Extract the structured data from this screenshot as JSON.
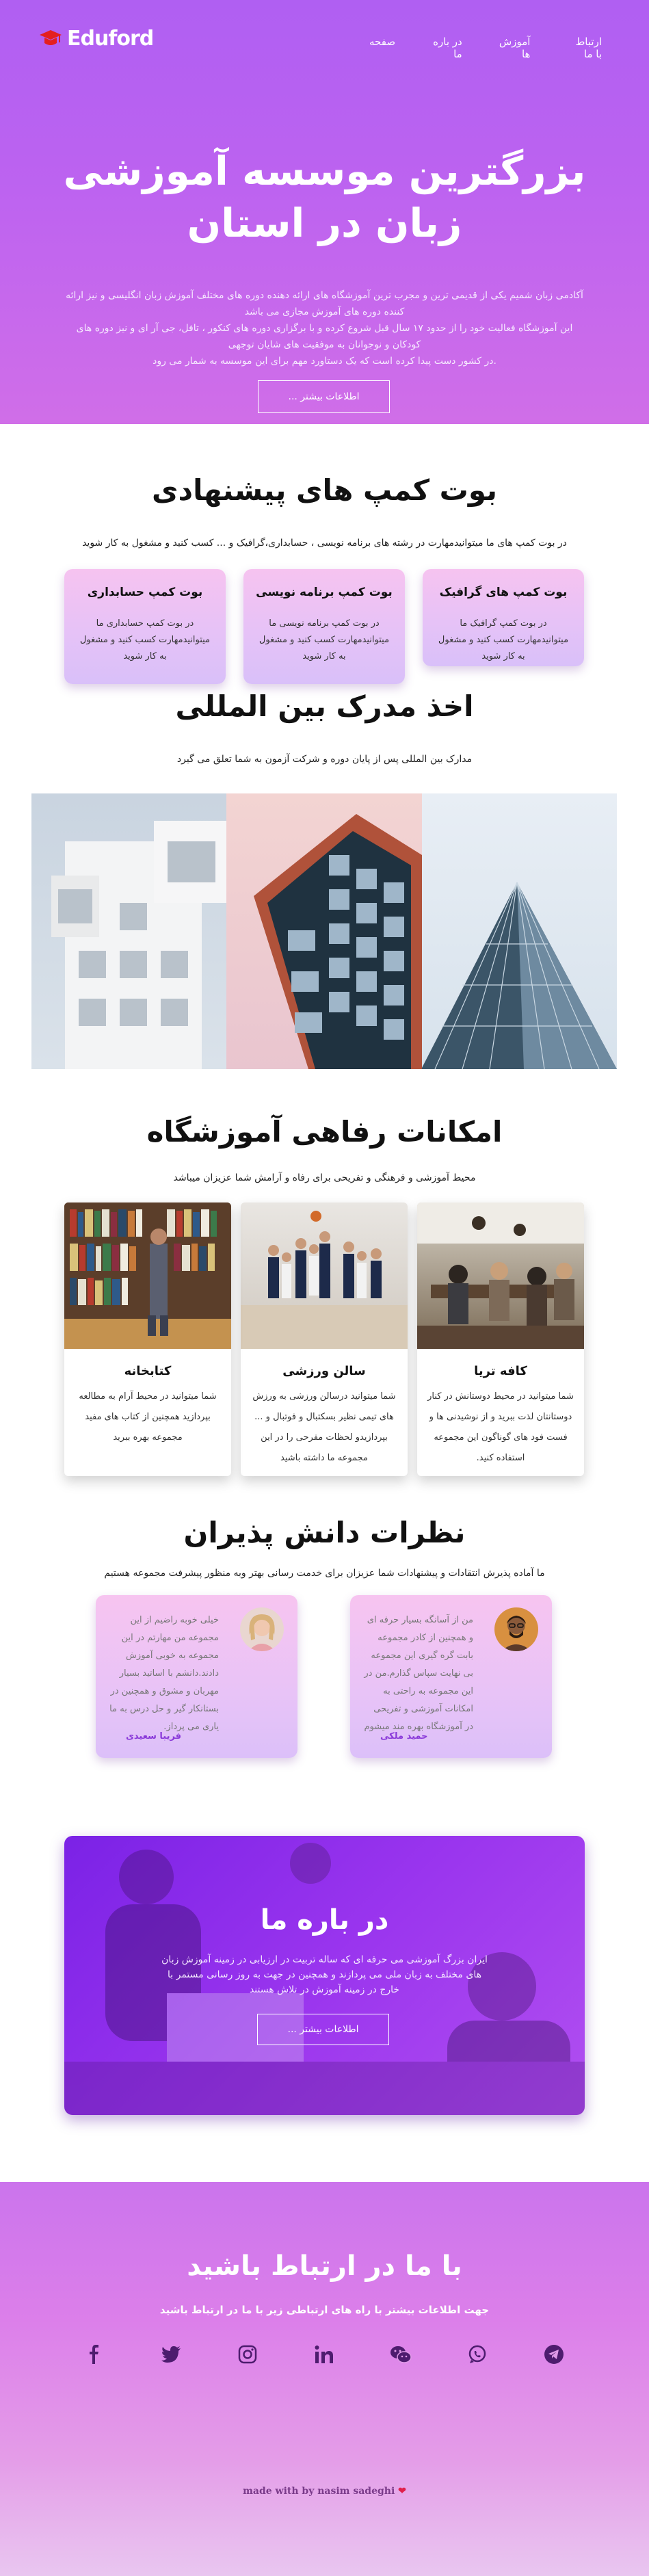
{
  "brand": {
    "name": "Eduford"
  },
  "nav": {
    "items": [
      "صفحه",
      "در باره ما",
      "آموزش ها",
      "ارتباط با ما"
    ]
  },
  "hero": {
    "title": "بزرگترین موسسه آموزشی زبان در استان",
    "desc_lines": [
      "آکادمی زبان شمیم یکی از قدیمی ترین و مجرب ترین آموزشگاه های ارائه دهنده دوره های مختلف آموزش زبان انگلیسی و نیز ارائه",
      "کننده دوره های آموزش مجازی می باشد",
      "این آموزشگاه فعالیت خود را از حدود ۱۷ سال قبل شروع کرده و با برگزاری دوره های کنکور ، تافل، جی آر ای و نیز دوره های",
      "کودکان و نوجوانان به موفقیت های شایان توجهی",
      ".در کشور دست پیدا کرده است که یک دستاورد مهم برای این موسسه به شمار می رود"
    ],
    "button": "اطلاعات بیشتر ..."
  },
  "bootcamps": {
    "title": "بوت کمپ های پیشنهادی",
    "subtitle": "در بوت کمپ های ما میتوانیدمهارت در رشته های برنامه نویسی ، حسابداری،گرافیک و ... کسب کنید و مشغول به کار شوید",
    "cards": [
      {
        "title": "بوت کمپ های گرافیک",
        "text": "در بوت کمپ گرافیک ما میتوانیدمهارت کسب کنید و مشغول به کار شوید"
      },
      {
        "title": "بوت کمپ برنامه نویسی",
        "text": "در بوت کمپ برنامه نویسی ما میتوانیدمهارت کسب کنید و مشغول به کار شوید"
      },
      {
        "title": "بوت کمپ حسابداری",
        "text": "در بوت کمپ حسابداری ما میتوانیدمهارت کسب کنید و مشغول به کار شوید"
      }
    ]
  },
  "certificate": {
    "title": "اخذ مدرک بین المللی",
    "subtitle": "مدارک بین المللی پس از پایان دوره و شرکت آزمون به شما تعلق می گیرد"
  },
  "facilities": {
    "title": "امکانات رفاهی آموزشگاه",
    "subtitle": "محیط آموزشی و فرهنگی و تفریحی برای رفاه و آرامش شما عزیزان میباشد",
    "cards": [
      {
        "title": "کافه تریا",
        "text": "شما میتوانید در محیط دوستانش در کنار دوستانتان لذت ببرید و از نوشیدنی ها و فست فود های گوناگون این مجموعه استفاده کنید."
      },
      {
        "title": "سالن ورزشی",
        "text": "شما میتوانید درسالن ورزشی به ورزش های تیمی نظیر بسکتبال و فوتبال و ... بپردازیدو لحظات مفرحی را در این مجموعه ما داشته باشید"
      },
      {
        "title": "کتابخانه",
        "text": "شما میتوانید در محیط آرام به مطالعه بپردازید همچنین از کتاب های مفید مجموعه بهره ببرید"
      }
    ]
  },
  "testimonials": {
    "title": "نظرات دانش پذیران",
    "subtitle": "ما آماده پذیرش انتقادات و پیشنهادات شما عزیزان برای خدمت رسانی بهتر وبه منظور پیشرفت مجموعه هستیم",
    "cards": [
      {
        "name": "حمید ملکی",
        "text": "من از آسانگه بسیار حرفه ای و همچنین از کادر مجموعه بابت گره گیری این مجموعه بی نهایت سپاس گذارم.من در این مجموعه به راحتی به امکانات آموزشی و تفریحی در آموزشگاه بهره مند میشوم"
      },
      {
        "name": "فریبا سعیدی",
        "text": "خیلی خوبه راضیم از این مجموعه من مهارتم در این مجموعه به خوبی آموزش دادند.دانشم با اساتید بسیار مهربان و مشوق و همچنین در بستانکار گیر و حل درس به ما یاری می پرداز."
      }
    ]
  },
  "about": {
    "title": "در باره ما",
    "desc": "ایران بزرگ آموزشی می حرفه ای که ساله تربیت در ارزیابی در زمینه آموزش زبان های مختلف به زبان ملی می پردازند و همچنین در جهت به روز رسانی مستمر با خارج در زمینه آموزش در تلاش هستند",
    "button": "اطلاعات بیشتر ..."
  },
  "contact": {
    "title": "با ما در ارتباط باشید",
    "subtitle": "جهت اطلاعات بیشتر با راه های ارتباطی زیر با ما در ارتباط باشید",
    "socials": [
      "facebook-icon",
      "twitter-icon",
      "instagram-icon",
      "linkedin-icon",
      "wechat-icon",
      "whatsapp-icon",
      "telegram-icon"
    ],
    "footer": "made with by nasim sadeghi"
  }
}
